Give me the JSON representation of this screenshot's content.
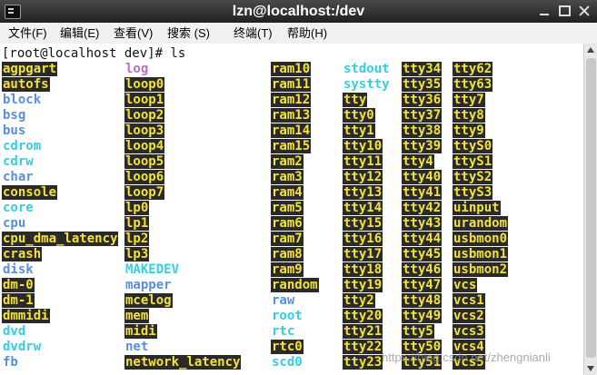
{
  "window": {
    "title": "lzn@localhost:/dev",
    "watermark": "https://blog.csdn.net/zhengnianli"
  },
  "menu": [
    {
      "label": "文件(F)"
    },
    {
      "label": "编辑(E)"
    },
    {
      "label": "查看(V)"
    },
    {
      "label": "搜索 (S)"
    },
    {
      "label": "终端(T)"
    },
    {
      "label": "帮助(H)"
    }
  ],
  "terminal": {
    "prompt": "[root@localhost dev]# ls",
    "colors": {
      "device": "#f4e23c",
      "device_bg": "#2a2a2a",
      "symlink": "#33cfe0",
      "directory": "#5a8fd8",
      "file": "#b86fc0"
    },
    "columns": [
      [
        {
          "name": "agpgart",
          "kind": "dev"
        },
        {
          "name": "autofs",
          "kind": "dev"
        },
        {
          "name": "block",
          "kind": "dir"
        },
        {
          "name": "bsg",
          "kind": "dir"
        },
        {
          "name": "bus",
          "kind": "dir"
        },
        {
          "name": "cdrom",
          "kind": "link"
        },
        {
          "name": "cdrw",
          "kind": "link"
        },
        {
          "name": "char",
          "kind": "dir"
        },
        {
          "name": "console",
          "kind": "dev"
        },
        {
          "name": "core",
          "kind": "link"
        },
        {
          "name": "cpu",
          "kind": "dir"
        },
        {
          "name": "cpu_dma_latency",
          "kind": "dev"
        },
        {
          "name": "crash",
          "kind": "dev"
        },
        {
          "name": "disk",
          "kind": "dir"
        },
        {
          "name": "dm-0",
          "kind": "dev"
        },
        {
          "name": "dm-1",
          "kind": "dev"
        },
        {
          "name": "dmmidi",
          "kind": "dev"
        },
        {
          "name": "dvd",
          "kind": "link"
        },
        {
          "name": "dvdrw",
          "kind": "link"
        },
        {
          "name": "fb",
          "kind": "dir"
        }
      ],
      [
        {
          "name": "log",
          "kind": "file"
        },
        {
          "name": "loop0",
          "kind": "dev"
        },
        {
          "name": "loop1",
          "kind": "dev"
        },
        {
          "name": "loop2",
          "kind": "dev"
        },
        {
          "name": "loop3",
          "kind": "dev"
        },
        {
          "name": "loop4",
          "kind": "dev"
        },
        {
          "name": "loop5",
          "kind": "dev"
        },
        {
          "name": "loop6",
          "kind": "dev"
        },
        {
          "name": "loop7",
          "kind": "dev"
        },
        {
          "name": "lp0",
          "kind": "dev"
        },
        {
          "name": "lp1",
          "kind": "dev"
        },
        {
          "name": "lp2",
          "kind": "dev"
        },
        {
          "name": "lp3",
          "kind": "dev"
        },
        {
          "name": "MAKEDEV",
          "kind": "link"
        },
        {
          "name": "mapper",
          "kind": "dir"
        },
        {
          "name": "mcelog",
          "kind": "dev"
        },
        {
          "name": "mem",
          "kind": "dev"
        },
        {
          "name": "midi",
          "kind": "dev"
        },
        {
          "name": "net",
          "kind": "dir"
        },
        {
          "name": "network_latency",
          "kind": "dev"
        }
      ],
      [
        {
          "name": "ram10",
          "kind": "dev"
        },
        {
          "name": "ram11",
          "kind": "dev"
        },
        {
          "name": "ram12",
          "kind": "dev"
        },
        {
          "name": "ram13",
          "kind": "dev"
        },
        {
          "name": "ram14",
          "kind": "dev"
        },
        {
          "name": "ram15",
          "kind": "dev"
        },
        {
          "name": "ram2",
          "kind": "dev"
        },
        {
          "name": "ram3",
          "kind": "dev"
        },
        {
          "name": "ram4",
          "kind": "dev"
        },
        {
          "name": "ram5",
          "kind": "dev"
        },
        {
          "name": "ram6",
          "kind": "dev"
        },
        {
          "name": "ram7",
          "kind": "dev"
        },
        {
          "name": "ram8",
          "kind": "dev"
        },
        {
          "name": "ram9",
          "kind": "dev"
        },
        {
          "name": "random",
          "kind": "dev"
        },
        {
          "name": "raw",
          "kind": "dir"
        },
        {
          "name": "root",
          "kind": "link"
        },
        {
          "name": "rtc",
          "kind": "link"
        },
        {
          "name": "rtc0",
          "kind": "dev"
        },
        {
          "name": "scd0",
          "kind": "link"
        }
      ],
      [
        {
          "name": "stdout",
          "kind": "link"
        },
        {
          "name": "systty",
          "kind": "link"
        },
        {
          "name": "tty",
          "kind": "dev"
        },
        {
          "name": "tty0",
          "kind": "dev"
        },
        {
          "name": "tty1",
          "kind": "dev"
        },
        {
          "name": "tty10",
          "kind": "dev"
        },
        {
          "name": "tty11",
          "kind": "dev"
        },
        {
          "name": "tty12",
          "kind": "dev"
        },
        {
          "name": "tty13",
          "kind": "dev"
        },
        {
          "name": "tty14",
          "kind": "dev"
        },
        {
          "name": "tty15",
          "kind": "dev"
        },
        {
          "name": "tty16",
          "kind": "dev"
        },
        {
          "name": "tty17",
          "kind": "dev"
        },
        {
          "name": "tty18",
          "kind": "dev"
        },
        {
          "name": "tty19",
          "kind": "dev"
        },
        {
          "name": "tty2",
          "kind": "dev"
        },
        {
          "name": "tty20",
          "kind": "dev"
        },
        {
          "name": "tty21",
          "kind": "dev"
        },
        {
          "name": "tty22",
          "kind": "dev"
        },
        {
          "name": "tty23",
          "kind": "dev"
        }
      ],
      [
        {
          "name": "tty34",
          "kind": "dev"
        },
        {
          "name": "tty35",
          "kind": "dev"
        },
        {
          "name": "tty36",
          "kind": "dev"
        },
        {
          "name": "tty37",
          "kind": "dev"
        },
        {
          "name": "tty38",
          "kind": "dev"
        },
        {
          "name": "tty39",
          "kind": "dev"
        },
        {
          "name": "tty4",
          "kind": "dev"
        },
        {
          "name": "tty40",
          "kind": "dev"
        },
        {
          "name": "tty41",
          "kind": "dev"
        },
        {
          "name": "tty42",
          "kind": "dev"
        },
        {
          "name": "tty43",
          "kind": "dev"
        },
        {
          "name": "tty44",
          "kind": "dev"
        },
        {
          "name": "tty45",
          "kind": "dev"
        },
        {
          "name": "tty46",
          "kind": "dev"
        },
        {
          "name": "tty47",
          "kind": "dev"
        },
        {
          "name": "tty48",
          "kind": "dev"
        },
        {
          "name": "tty49",
          "kind": "dev"
        },
        {
          "name": "tty5",
          "kind": "dev"
        },
        {
          "name": "tty50",
          "kind": "dev"
        },
        {
          "name": "tty51",
          "kind": "dev"
        }
      ],
      [
        {
          "name": "tty62",
          "kind": "dev"
        },
        {
          "name": "tty63",
          "kind": "dev"
        },
        {
          "name": "tty7",
          "kind": "dev"
        },
        {
          "name": "tty8",
          "kind": "dev"
        },
        {
          "name": "tty9",
          "kind": "dev"
        },
        {
          "name": "ttyS0",
          "kind": "dev"
        },
        {
          "name": "ttyS1",
          "kind": "dev"
        },
        {
          "name": "ttyS2",
          "kind": "dev"
        },
        {
          "name": "ttyS3",
          "kind": "dev"
        },
        {
          "name": "uinput",
          "kind": "dev"
        },
        {
          "name": "urandom",
          "kind": "dev"
        },
        {
          "name": "usbmon0",
          "kind": "dev"
        },
        {
          "name": "usbmon1",
          "kind": "dev"
        },
        {
          "name": "usbmon2",
          "kind": "dev"
        },
        {
          "name": "vcs",
          "kind": "dev"
        },
        {
          "name": "vcs1",
          "kind": "dev"
        },
        {
          "name": "vcs2",
          "kind": "dev"
        },
        {
          "name": "vcs3",
          "kind": "dev"
        },
        {
          "name": "vcs4",
          "kind": "dev"
        },
        {
          "name": "vcs5",
          "kind": "dev"
        }
      ]
    ]
  }
}
